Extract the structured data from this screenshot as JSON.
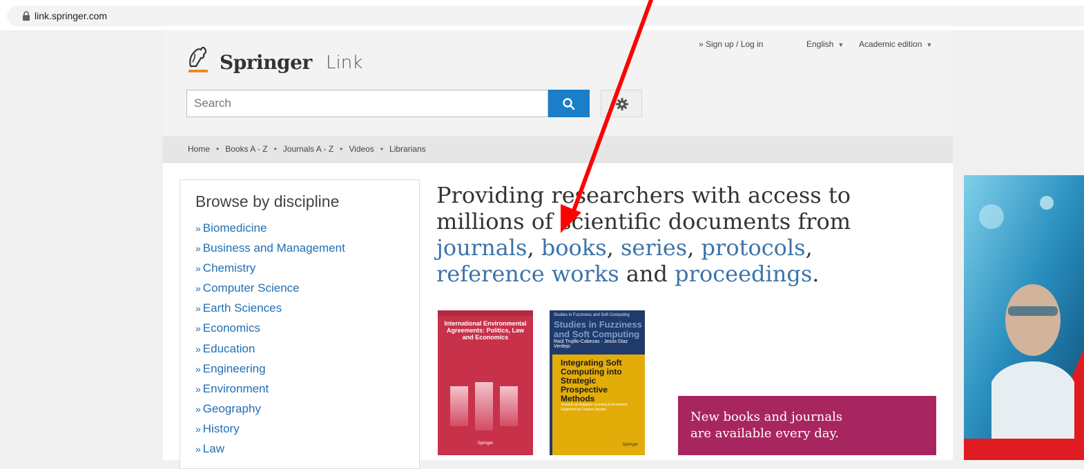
{
  "browser": {
    "url": "link.springer.com"
  },
  "header": {
    "logo_primary": "Springer",
    "logo_secondary": "Link",
    "signup_label": "» Sign up / Log in",
    "language": "English",
    "edition": "Academic edition"
  },
  "search": {
    "placeholder": "Search"
  },
  "nav": {
    "items": [
      "Home",
      "Books A - Z",
      "Journals A - Z",
      "Videos",
      "Librarians"
    ]
  },
  "browse": {
    "title": "Browse by discipline",
    "items": [
      "Biomedicine",
      "Business and Management",
      "Chemistry",
      "Computer Science",
      "Earth Sciences",
      "Economics",
      "Education",
      "Engineering",
      "Environment",
      "Geography",
      "History",
      "Law"
    ]
  },
  "headline": {
    "line1": "Providing researchers with access to",
    "line2": "millions of scientific documents from",
    "links": [
      "journals",
      "books",
      "series",
      "protocols",
      "reference works",
      "proceedings"
    ],
    "sep_comma": ", ",
    "and": " and ",
    "period": "."
  },
  "covers": [
    {
      "title": "International Environmental Agreements: Politics, Law and Economics",
      "publisher": "Springer"
    },
    {
      "series": "Studies in Fuzziness and Soft Computing",
      "series_big": "Studies in Fuzziness and Soft Computing",
      "authors": "Raúl Trujillo-Cabezas · Jesús Díaz Verdejo",
      "title": "Integrating Soft Computing into Strategic Prospective Methods",
      "subtitle": "Towards an Adaptive Learning Environment Supported by Futures Studies",
      "publisher": "Springer"
    }
  ],
  "promo": {
    "line1": "New books and journals",
    "line2": "are available every day."
  },
  "colors": {
    "link": "#1f6fb4",
    "search_button": "#1a7ec9",
    "promo": "#a8265f",
    "annotation_arrow": "#ff0000"
  }
}
